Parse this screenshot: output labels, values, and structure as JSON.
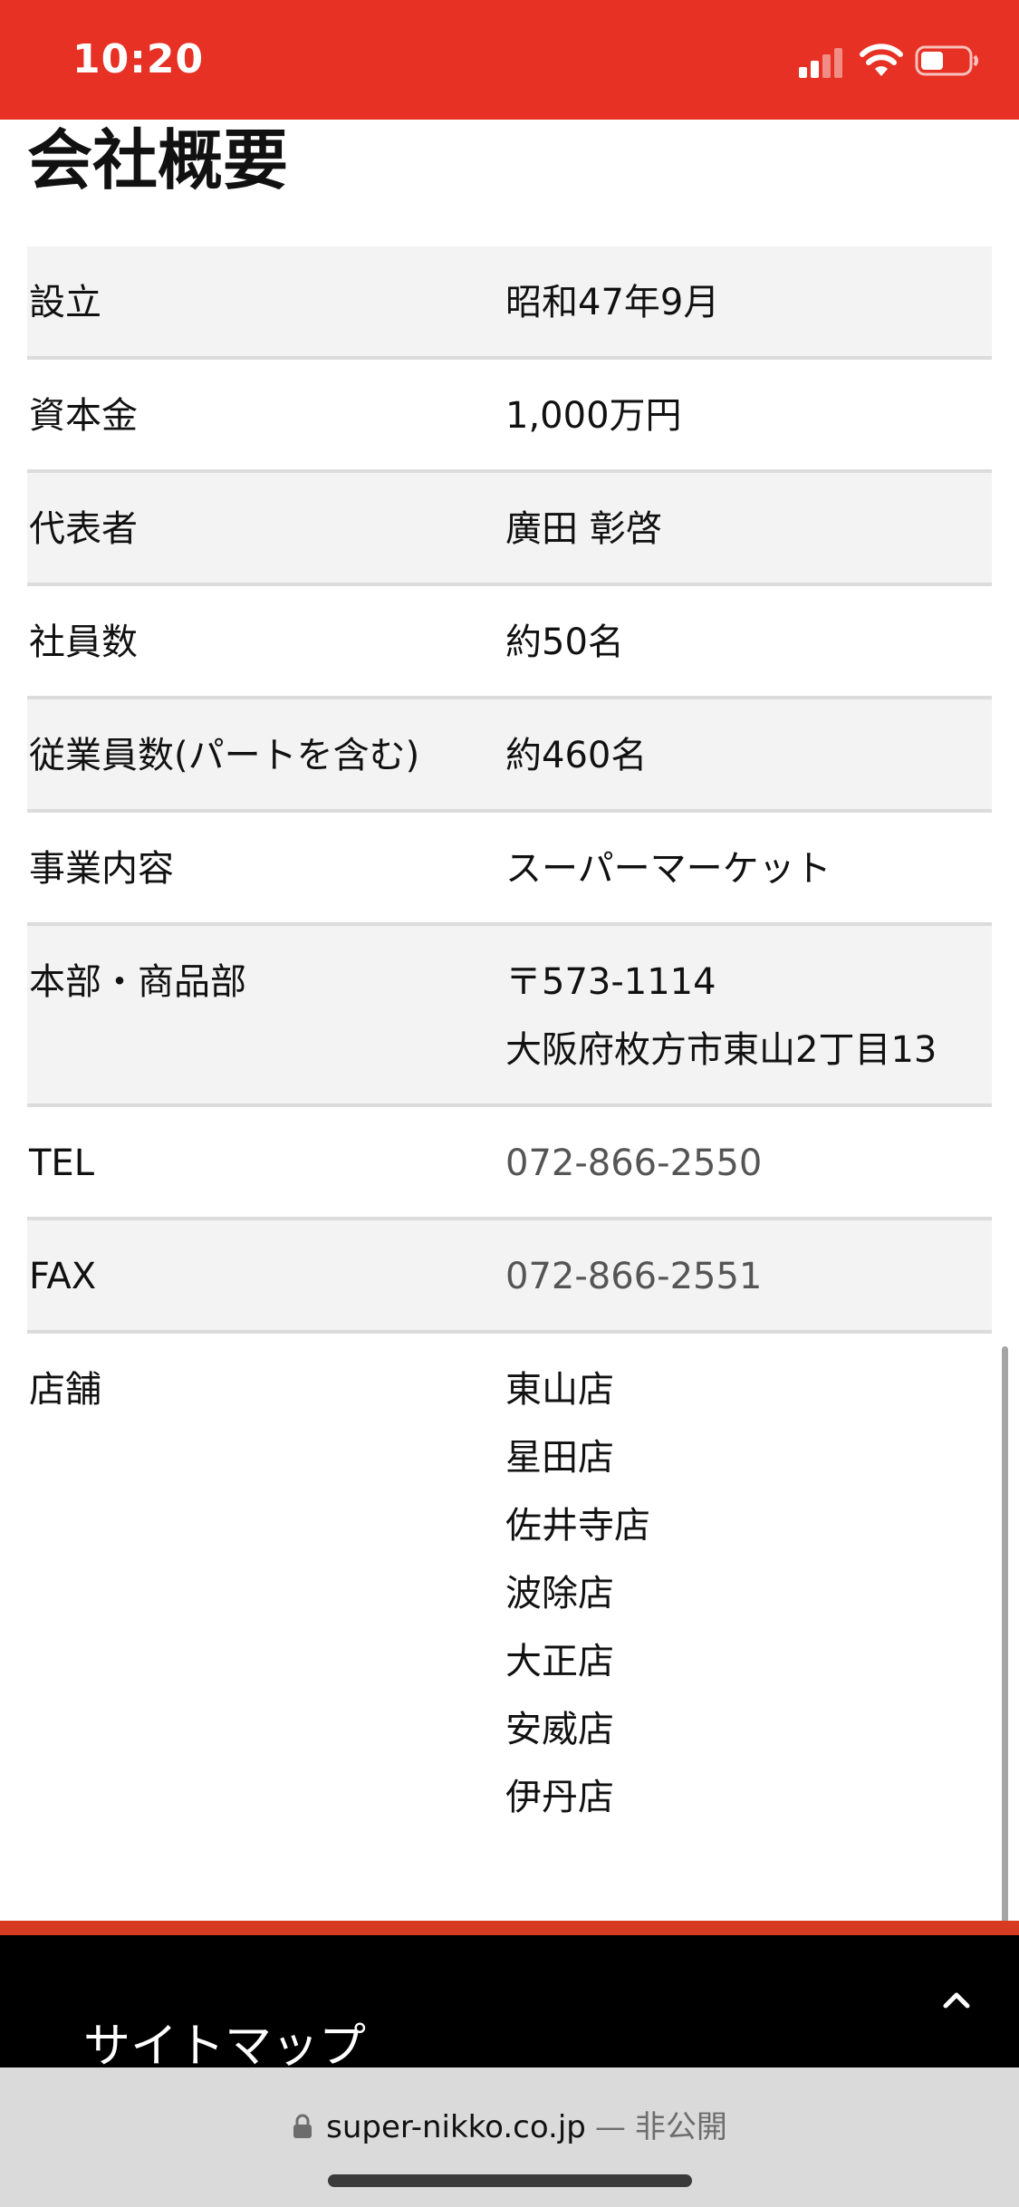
{
  "status_bar": {
    "time": "10:20",
    "background": "#e63124"
  },
  "heading": "会社概要",
  "rows": [
    {
      "label": [
        "設立"
      ],
      "values": [
        "昭和47年9月"
      ]
    },
    {
      "label": [
        "資本金"
      ],
      "values": [
        "1,000万円"
      ]
    },
    {
      "label": [
        "代表者"
      ],
      "values": [
        "廣田 彰啓"
      ]
    },
    {
      "label": [
        "社員数"
      ],
      "values": [
        "約50名"
      ]
    },
    {
      "label": [
        "従業員数(パートを含む)"
      ],
      "values": [
        "約460名"
      ]
    },
    {
      "label": [
        "事業内容"
      ],
      "values": [
        "スーパーマーケット"
      ]
    },
    {
      "label": [
        "本部・商品部"
      ],
      "values": [
        "〒573-1114",
        "大阪府枚方市東山2丁目13"
      ]
    },
    {
      "label": [
        "TEL"
      ],
      "values": [
        "072-866-2550"
      ]
    },
    {
      "label": [
        "FAX"
      ],
      "values": [
        "072-866-2551"
      ]
    },
    {
      "label": [
        "店舗"
      ],
      "values": [
        "東山店",
        "星田店",
        "佐井寺店",
        "波除店",
        "大正店",
        "安威店",
        "伊丹店"
      ]
    }
  ],
  "footer": {
    "sitemap_title": "サイトマップ",
    "back_to_top_icon": "chevron-up-icon"
  },
  "browser": {
    "domain": "super-nikko.co.jp",
    "separator": "—",
    "status": "非公開",
    "lock_icon": "lock-icon"
  }
}
